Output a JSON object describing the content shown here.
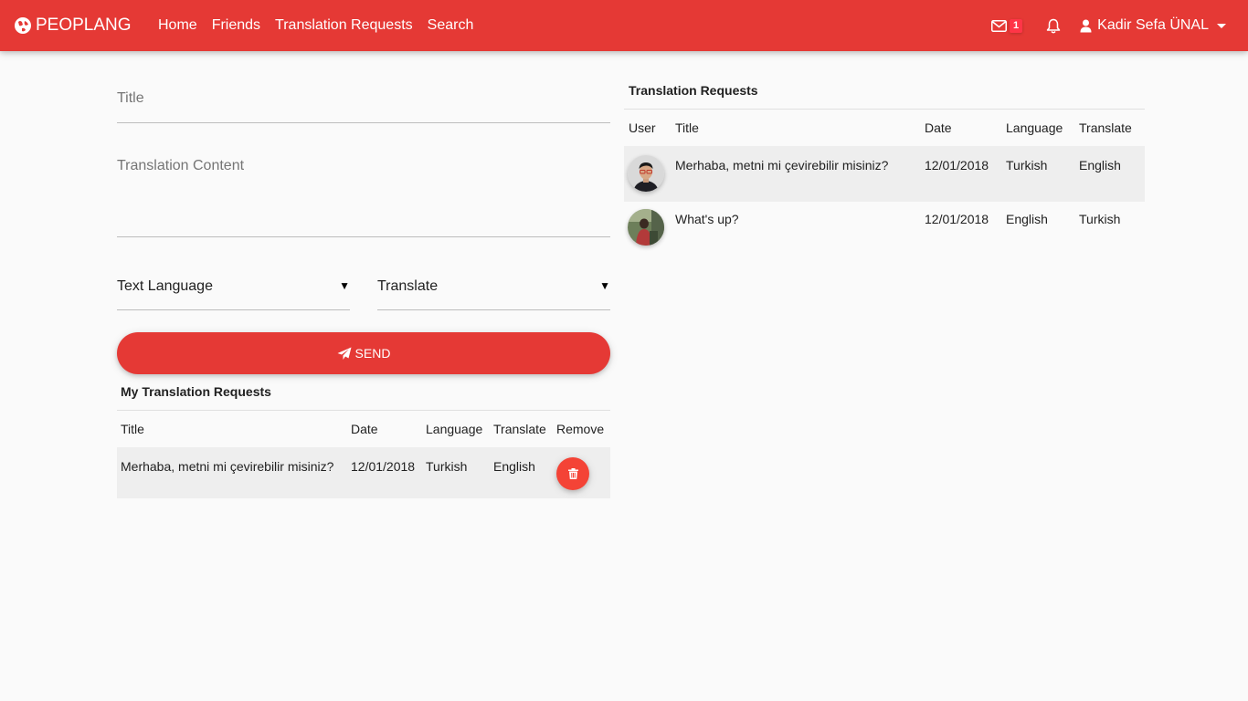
{
  "navbar": {
    "brand": "PEOPLANG",
    "links": [
      "Home",
      "Friends",
      "Translation Requests",
      "Search"
    ],
    "mail_count": "1",
    "user_name": "Kadir Sefa ÜNAL"
  },
  "form": {
    "title_placeholder": "Title",
    "content_placeholder": "Translation Content",
    "text_language": "Text Language",
    "translate": "Translate",
    "send_label": "SEND"
  },
  "my_requests": {
    "heading": "My Translation Requests",
    "columns": [
      "Title",
      "Date",
      "Language",
      "Translate",
      "Remove"
    ],
    "rows": [
      {
        "title": "Merhaba, metni mi çevirebilir misiniz?",
        "date": "12/01/2018",
        "language": "Turkish",
        "translate": "English"
      }
    ]
  },
  "requests": {
    "heading": "Translation Requests",
    "columns": [
      "User",
      "Title",
      "Date",
      "Language",
      "Translate"
    ],
    "rows": [
      {
        "title": "Merhaba, metni mi çevirebilir misiniz?",
        "date": "12/01/2018",
        "language": "Turkish",
        "translate": "English"
      },
      {
        "title": "What's up?",
        "date": "12/01/2018",
        "language": "English",
        "translate": "Turkish"
      }
    ]
  },
  "colors": {
    "primary": "#e53935",
    "badge": "#ff3547",
    "remove": "#f44336",
    "row_highlight": "#eeeeee"
  }
}
